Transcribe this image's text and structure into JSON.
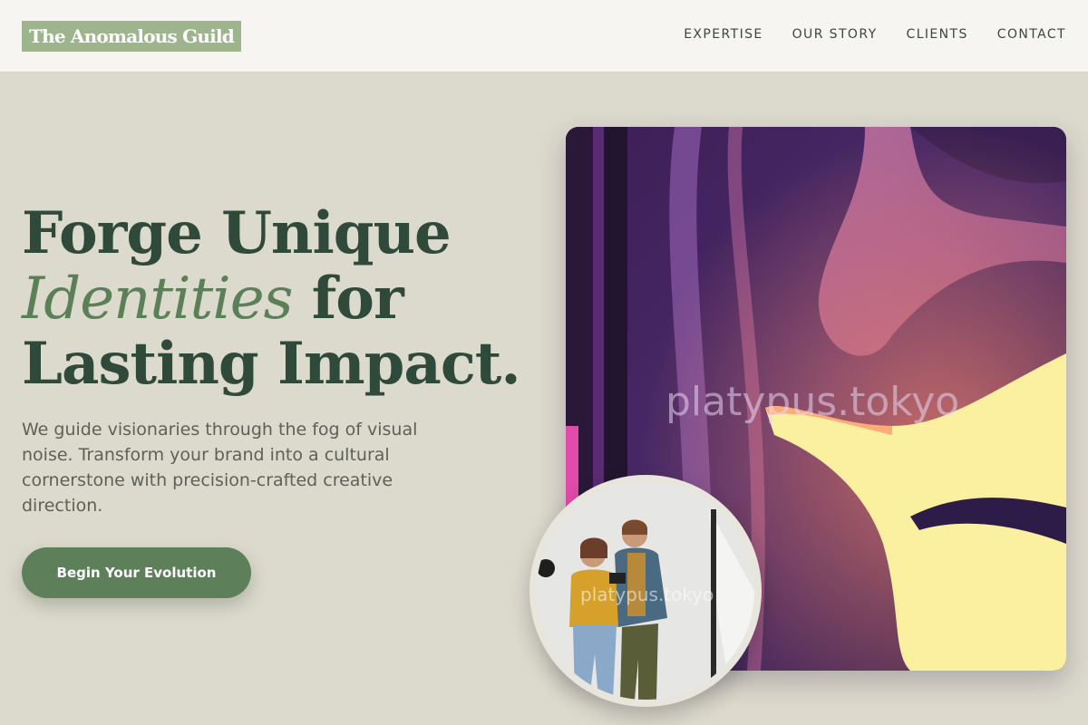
{
  "header": {
    "logo": "The Anomalous Guild",
    "nav": [
      "EXPERTISE",
      "OUR STORY",
      "CLIENTS",
      "CONTACT"
    ]
  },
  "hero": {
    "headline_line1": "Forge Unique",
    "headline_accent": "Identities",
    "headline_line2_rest": " for",
    "headline_line3": "Lasting Impact.",
    "subtext": "We guide visionaries through the fog of visual noise. Transform your brand into a cultural cornerstone with precision-crafted creative direction.",
    "cta_label": "Begin Your Evolution"
  },
  "media": {
    "art_watermark": "platypus.tokyo",
    "photo_watermark": "platypus.tokyo"
  },
  "colors": {
    "background": "#dcd9cd",
    "header_bg": "#f6f5f2",
    "logo_bg": "#9eb48c",
    "headline": "#2f4a3a",
    "accent": "#5b7f57",
    "cta_bg": "#5d7f59"
  }
}
